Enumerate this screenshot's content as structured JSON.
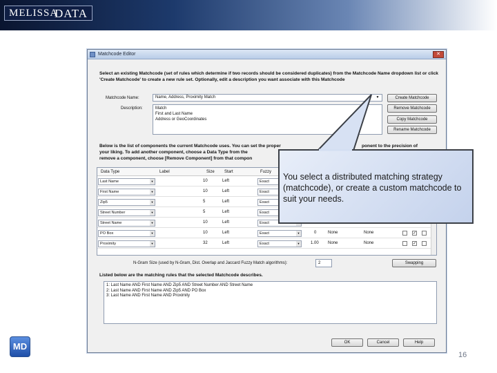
{
  "brand": {
    "logo_left": "MELISSA",
    "logo_right": "DATA",
    "footer_logo": "MD"
  },
  "page_number": "16",
  "dialog": {
    "title": "Matchcode Editor",
    "close_glyph": "✕",
    "intro": "Select an existing Matchcode (set of rules which determine if two records should be considered duplicates) from the Matchcode Name dropdown list or click 'Create Matchcode' to create a new rule set. Optionally, edit a description you want associate with this Matchcode",
    "matchcode_name_label": "Matchcode Name:",
    "matchcode_name_value": "Name, Address, Proximity Match",
    "description_label": "Description:",
    "description_lines": [
      "Match",
      "First and Last Name",
      "Address or GeoCoordinates"
    ],
    "buttons": {
      "create": "Create Matchcode",
      "remove": "Remove Matchcode",
      "copy": "Copy Matchcode",
      "rename": "Rename Matchcode",
      "swapping": "Swapping",
      "ok": "OK",
      "cancel": "Cancel",
      "help": "Help"
    },
    "components_text_line1": "Below is the list of components the current Matchcode uses. You can set the proper",
    "components_text_line1_tail": "ponent to the precision of",
    "components_text_line2": "your liking. To add another component, choose a Data Type from the",
    "components_text_line3": "remove a component, choose [Remove Component] from that compon",
    "grid": {
      "headers": [
        "Data Type",
        "Label",
        "Size",
        "Start",
        "Fuzzy"
      ],
      "rows": [
        {
          "type": "Last Name",
          "size": "10",
          "start": "Left",
          "fuzzy": "Exact"
        },
        {
          "type": "First Name",
          "size": "10",
          "start": "Left",
          "fuzzy": "Exact"
        },
        {
          "type": "Zip5",
          "size": "5",
          "start": "Left",
          "fuzzy": "Exact"
        },
        {
          "type": "Street Number",
          "size": "5",
          "start": "Left",
          "fuzzy": "Exact"
        },
        {
          "type": "Street Name",
          "size": "10",
          "start": "Left",
          "fuzzy": "Exact"
        },
        {
          "type": "PO Box",
          "size": "10",
          "start": "Left",
          "fuzzy": "Exact",
          "num": "0",
          "c1": "None",
          "c2": "None",
          "check2": true
        },
        {
          "type": "Proximity",
          "size": "32",
          "start": "Left",
          "fuzzy": "Exact",
          "num": "1.00",
          "c1": "None",
          "c2": "None",
          "check2": true
        }
      ]
    },
    "ngram_label": "N-Gram Size (used by N-Gram, Dist. Overlap and Jaccard Fuzzy Match algorithms):",
    "ngram_value": "2",
    "rules_title": "Listed below are the matching rules that the selected Matchcode describes.",
    "rules": [
      "1: Last Name AND First Name AND Zip5 AND Street Number AND Street Name",
      "2: Last Name AND First Name AND Zip5 AND PO Box",
      "3: Last Name AND First Name AND Proximity"
    ]
  },
  "callout": {
    "text": "You select a distributed matching strategy (matchcode), or create a custom matchcode to suit your needs."
  }
}
